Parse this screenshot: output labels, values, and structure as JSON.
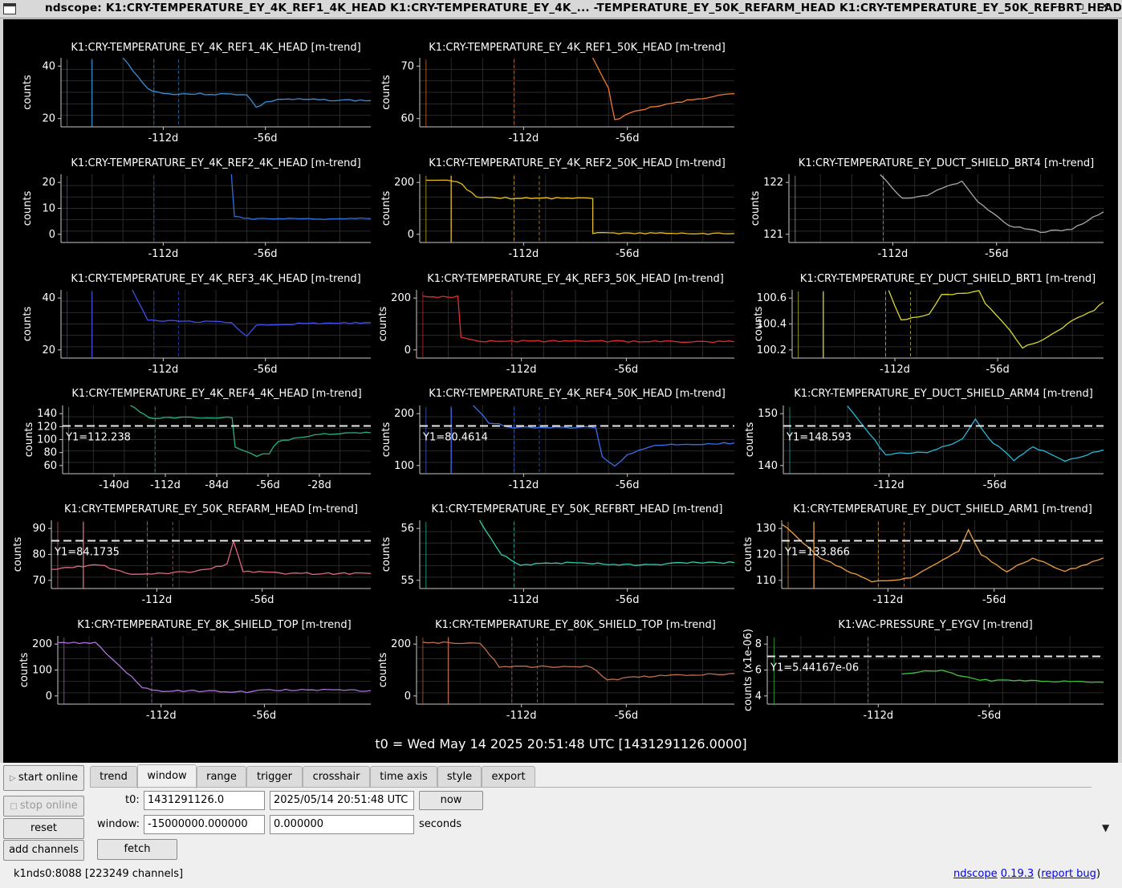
{
  "window": {
    "title": "ndscope: K1:CRY-TEMPERATURE_EY_4K_REF1_4K_HEAD K1:CRY-TEMPERATURE_EY_4K_... -TEMPERATURE_EY_50K_REFARM_HEAD K1:CRY-TEMPERATURE_EY_50K_REFBRT_HEAD",
    "controls": "–  ▫  ✕"
  },
  "plots": [
    {
      "title": "K1:CRY-TEMPERATURE_EY_4K_REF1_4K_HEAD [m-trend]",
      "ylabel": "counts",
      "color": "#3a8fd8",
      "yticks": [
        "40",
        "20"
      ],
      "xticks": [
        "-112d",
        "-56d"
      ],
      "cursor": null,
      "shape": [
        [
          0.2,
          0.0
        ],
        [
          0.28,
          0.45
        ],
        [
          0.33,
          0.52
        ],
        [
          0.6,
          0.53
        ],
        [
          0.63,
          0.72
        ],
        [
          0.66,
          0.65
        ],
        [
          0.7,
          0.6
        ],
        [
          1.0,
          0.62
        ]
      ]
    },
    {
      "title": "K1:CRY-TEMPERATURE_EY_4K_REF1_50K_HEAD [m-trend]",
      "ylabel": "counts",
      "color": "#f07a30",
      "yticks": [
        "70",
        "60"
      ],
      "xticks": [
        "-112d",
        "-56d"
      ],
      "cursor": null,
      "shape": [
        [
          0.55,
          0.0
        ],
        [
          0.6,
          0.45
        ],
        [
          0.62,
          0.9
        ],
        [
          0.7,
          0.75
        ],
        [
          0.85,
          0.62
        ],
        [
          1.0,
          0.52
        ]
      ]
    },
    null,
    {
      "title": "K1:CRY-TEMPERATURE_EY_4K_REF2_4K_HEAD [m-trend]",
      "ylabel": "counts",
      "color": "#2f6ee0",
      "yticks": [
        "20",
        "10",
        "0"
      ],
      "xticks": [
        "-112d",
        "-56d"
      ],
      "cursor": null,
      "shape": [
        [
          0.55,
          0.0
        ],
        [
          0.56,
          0.62
        ],
        [
          0.62,
          0.65
        ],
        [
          1.0,
          0.65
        ]
      ]
    },
    {
      "title": "K1:CRY-TEMPERATURE_EY_4K_REF2_50K_HEAD [m-trend]",
      "ylabel": "counts",
      "color": "#e8c020",
      "yticks": [
        "200",
        "0"
      ],
      "xticks": [
        "-112d",
        "-56d"
      ],
      "cursor": null,
      "shape": [
        [
          0.02,
          0.1
        ],
        [
          0.12,
          0.1
        ],
        [
          0.18,
          0.33
        ],
        [
          0.24,
          0.35
        ],
        [
          0.55,
          0.35
        ],
        [
          0.55,
          0.86
        ],
        [
          1.0,
          0.87
        ]
      ]
    },
    {
      "title": "K1:CRY-TEMPERATURE_EY_DUCT_SHIELD_BRT4 [m-trend]",
      "ylabel": "counts",
      "color": "#a8a8a8",
      "yticks": [
        "122",
        "121"
      ],
      "xticks": [
        "-112d",
        "-56d"
      ],
      "cursor": null,
      "shape": [
        [
          0.29,
          0.0
        ],
        [
          0.36,
          0.36
        ],
        [
          0.44,
          0.3
        ],
        [
          0.55,
          0.1
        ],
        [
          0.6,
          0.4
        ],
        [
          0.7,
          0.75
        ],
        [
          0.8,
          0.85
        ],
        [
          0.9,
          0.8
        ],
        [
          1.0,
          0.55
        ]
      ]
    },
    {
      "title": "K1:CRY-TEMPERATURE_EY_4K_REF3_4K_HEAD [m-trend]",
      "ylabel": "counts",
      "color": "#3c4ef0",
      "yticks": [
        "40",
        "20"
      ],
      "xticks": [
        "-112d",
        "-56d"
      ],
      "cursor": null,
      "shape": [
        [
          0.23,
          0.0
        ],
        [
          0.28,
          0.45
        ],
        [
          0.33,
          0.45
        ],
        [
          0.55,
          0.48
        ],
        [
          0.6,
          0.68
        ],
        [
          0.63,
          0.52
        ],
        [
          0.75,
          0.5
        ],
        [
          1.0,
          0.48
        ]
      ]
    },
    {
      "title": "K1:CRY-TEMPERATURE_EY_4K_REF3_50K_HEAD [m-trend]",
      "ylabel": "counts",
      "color": "#e03030",
      "yticks": [
        "200",
        "0"
      ],
      "xticks": [
        "-112d",
        "-56d"
      ],
      "cursor": null,
      "shape": [
        [
          0.02,
          0.1
        ],
        [
          0.13,
          0.1
        ],
        [
          0.14,
          0.7
        ],
        [
          0.2,
          0.75
        ],
        [
          1.0,
          0.76
        ]
      ]
    },
    {
      "title": "K1:CRY-TEMPERATURE_EY_DUCT_SHIELD_BRT1 [m-trend]",
      "ylabel": "counts",
      "color": "#d8d830",
      "yticks": [
        "100.6",
        "100.4",
        "100.2"
      ],
      "xticks": [
        "-112d",
        "-56d"
      ],
      "cursor": null,
      "shape": [
        [
          0.31,
          0.0
        ],
        [
          0.35,
          0.45
        ],
        [
          0.44,
          0.35
        ],
        [
          0.48,
          0.08
        ],
        [
          0.6,
          0.02
        ],
        [
          0.62,
          0.2
        ],
        [
          0.7,
          0.6
        ],
        [
          0.74,
          0.85
        ],
        [
          0.82,
          0.7
        ],
        [
          0.9,
          0.45
        ],
        [
          0.97,
          0.3
        ],
        [
          1.0,
          0.18
        ]
      ]
    },
    {
      "title": "K1:CRY-TEMPERATURE_EY_4K_REF4_4K_HEAD [m-trend]",
      "ylabel": "counts",
      "color": "#28b080",
      "yticks": [
        "140",
        "120",
        "100",
        "80",
        "60"
      ],
      "xticks": [
        "-140d",
        "-112d",
        "-84d",
        "-56d",
        "-28d"
      ],
      "cursor": "Y1=112.238",
      "shape": [
        [
          0.22,
          0.0
        ],
        [
          0.28,
          0.18
        ],
        [
          0.55,
          0.18
        ],
        [
          0.56,
          0.62
        ],
        [
          0.63,
          0.74
        ],
        [
          0.67,
          0.7
        ],
        [
          0.7,
          0.52
        ],
        [
          0.85,
          0.42
        ],
        [
          1.0,
          0.4
        ]
      ]
    },
    {
      "title": "K1:CRY-TEMPERATURE_EY_4K_REF4_50K_HEAD [m-trend]",
      "ylabel": "counts",
      "color": "#3870f0",
      "yticks": [
        "200",
        "100"
      ],
      "xticks": [
        "-112d",
        "-56d"
      ],
      "cursor": "Y1=80.4614",
      "shape": [
        [
          0.17,
          0.0
        ],
        [
          0.22,
          0.25
        ],
        [
          0.3,
          0.32
        ],
        [
          0.56,
          0.32
        ],
        [
          0.58,
          0.75
        ],
        [
          0.62,
          0.9
        ],
        [
          0.66,
          0.72
        ],
        [
          0.75,
          0.58
        ],
        [
          1.0,
          0.55
        ]
      ]
    },
    {
      "title": "K1:CRY-TEMPERATURE_EY_DUCT_SHIELD_ARM4 [m-trend]",
      "ylabel": "counts",
      "color": "#28b8d8",
      "yticks": [
        "150",
        "140"
      ],
      "xticks": [
        "-112d",
        "-56d"
      ],
      "cursor": "Y1=148.593",
      "shape": [
        [
          0.2,
          0.0
        ],
        [
          0.32,
          0.72
        ],
        [
          0.45,
          0.68
        ],
        [
          0.56,
          0.5
        ],
        [
          0.6,
          0.2
        ],
        [
          0.64,
          0.48
        ],
        [
          0.72,
          0.8
        ],
        [
          0.78,
          0.6
        ],
        [
          0.88,
          0.82
        ],
        [
          1.0,
          0.65
        ]
      ]
    },
    {
      "title": "K1:CRY-TEMPERATURE_EY_50K_REFARM_HEAD [m-trend]",
      "ylabel": "counts",
      "color": "#e06880",
      "yticks": [
        "90",
        "80",
        "70"
      ],
      "xticks": [
        "-112d",
        "-56d"
      ],
      "cursor": "Y1=84.1735",
      "shape": [
        [
          0.0,
          0.72
        ],
        [
          0.15,
          0.65
        ],
        [
          0.25,
          0.8
        ],
        [
          0.45,
          0.75
        ],
        [
          0.55,
          0.65
        ],
        [
          0.57,
          0.3
        ],
        [
          0.6,
          0.75
        ],
        [
          0.75,
          0.78
        ],
        [
          0.9,
          0.78
        ],
        [
          1.0,
          0.78
        ]
      ]
    },
    {
      "title": "K1:CRY-TEMPERATURE_EY_50K_REFBRT_HEAD [m-trend]",
      "ylabel": "counts",
      "color": "#30d0b0",
      "yticks": [
        "56",
        "55"
      ],
      "xticks": [
        "-112d",
        "-56d"
      ],
      "cursor": null,
      "shape": [
        [
          0.19,
          0.0
        ],
        [
          0.26,
          0.5
        ],
        [
          0.32,
          0.65
        ],
        [
          0.5,
          0.62
        ],
        [
          0.7,
          0.66
        ],
        [
          0.85,
          0.62
        ],
        [
          1.0,
          0.62
        ]
      ]
    },
    {
      "title": "K1:CRY-TEMPERATURE_EY_DUCT_SHIELD_ARM1 [m-trend]",
      "ylabel": "counts",
      "color": "#f0a040",
      "yticks": [
        "130",
        "120",
        "110"
      ],
      "xticks": [
        "-112d",
        "-56d"
      ],
      "cursor": "Y1=133.866",
      "shape": [
        [
          0.0,
          0.05
        ],
        [
          0.12,
          0.55
        ],
        [
          0.28,
          0.9
        ],
        [
          0.4,
          0.85
        ],
        [
          0.55,
          0.45
        ],
        [
          0.58,
          0.15
        ],
        [
          0.62,
          0.5
        ],
        [
          0.7,
          0.75
        ],
        [
          0.78,
          0.55
        ],
        [
          0.88,
          0.75
        ],
        [
          1.0,
          0.55
        ]
      ]
    },
    {
      "title": "K1:CRY-TEMPERATURE_EY_8K_SHIELD_TOP [m-trend]",
      "ylabel": "counts",
      "color": "#b070e0",
      "yticks": [
        "200",
        "100",
        "0"
      ],
      "xticks": [
        "-112d",
        "-56d"
      ],
      "cursor": null,
      "shape": [
        [
          0.0,
          0.1
        ],
        [
          0.12,
          0.1
        ],
        [
          0.27,
          0.75
        ],
        [
          0.3,
          0.8
        ],
        [
          0.62,
          0.82
        ],
        [
          0.66,
          0.79
        ],
        [
          1.0,
          0.8
        ]
      ]
    },
    {
      "title": "K1:CRY-TEMPERATURE_EY_80K_SHIELD_TOP [m-trend]",
      "ylabel": "counts",
      "color": "#c07050",
      "yticks": [
        "200",
        "0"
      ],
      "xticks": [
        "-112d",
        "-56d"
      ],
      "cursor": null,
      "shape": [
        [
          0.02,
          0.1
        ],
        [
          0.2,
          0.1
        ],
        [
          0.26,
          0.45
        ],
        [
          0.55,
          0.45
        ],
        [
          0.6,
          0.65
        ],
        [
          0.7,
          0.6
        ],
        [
          1.0,
          0.55
        ]
      ]
    },
    {
      "title": "K1:VAC-PRESSURE_Y_EYGV [m-trend]",
      "ylabel": "counts (x1e-06)",
      "color": "#40c040",
      "yticks": [
        "8",
        "6",
        "4"
      ],
      "xticks": [
        "-112d",
        "-56d"
      ],
      "cursor": "Y1=5.44167e-06",
      "shape": [
        [
          0.4,
          0.55
        ],
        [
          0.52,
          0.5
        ],
        [
          0.58,
          0.6
        ],
        [
          0.65,
          0.65
        ],
        [
          1.0,
          0.68
        ]
      ]
    }
  ],
  "t0_line": "t0 = Wed May 14 2025 20:51:48 UTC [1431291126.0000]",
  "buttons": {
    "start_online": "start online",
    "stop_online": "stop online",
    "reset": "reset",
    "add_channels": "add channels",
    "now": "now",
    "fetch": "fetch"
  },
  "tabs": [
    "trend",
    "window",
    "range",
    "trigger",
    "crosshair",
    "time axis",
    "style",
    "export"
  ],
  "window_tab": {
    "t0_label": "t0:",
    "t0_gps": "1431291126.0",
    "t0_utc": "2025/05/14 20:51:48 UTC",
    "window_label": "window:",
    "window_start": "-15000000.000000",
    "window_end": "0.000000",
    "seconds_label": "seconds"
  },
  "status": {
    "server": "k1nds0:8088  [223249 channels]",
    "app_name": "ndscope",
    "version": "0.19.3",
    "paren_open": "(",
    "report_bug": "report bug",
    "paren_close": ")"
  }
}
